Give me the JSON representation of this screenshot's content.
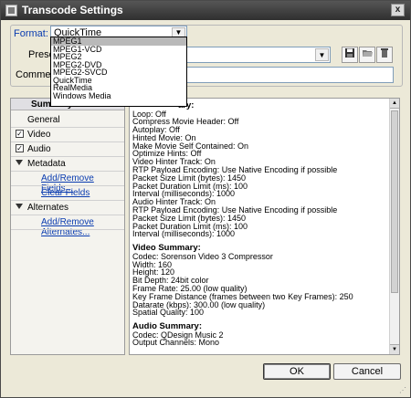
{
  "window": {
    "title": "Transcode Settings",
    "close_glyph": "x"
  },
  "format": {
    "label": "Format:",
    "value": "QuickTime"
  },
  "preset": {
    "label": "Preset",
    "value": ""
  },
  "comment": {
    "label": "Comment",
    "value": ""
  },
  "dropdown": {
    "options": [
      "MPEG1",
      "MPEG1-VCD",
      "MPEG2",
      "MPEG2-DVD",
      "MPEG2-SVCD",
      "QuickTime",
      "RealMedia",
      "Windows Media"
    ],
    "selected_index": 0
  },
  "toolbar": {
    "save_icon": "floppy-disk-icon",
    "open_icon": "folder-icon",
    "delete_icon": "trash-icon"
  },
  "tree": {
    "header": "Summary",
    "general": "General",
    "video": "Video",
    "audio": "Audio",
    "metadata": "Metadata",
    "add_remove_fields": "Add/Remove Fields...",
    "clear_fields": "Clear Fields",
    "alternates": "Alternates",
    "add_remove_alternates": "Add/Remove Alternates..."
  },
  "summary": {
    "partial_heading": "ary:",
    "general_lines": [
      "Loop: Off",
      "Compress Movie Header: Off",
      "Autoplay: Off",
      "Hinted Movie: On",
      "Make Movie Self Contained: On",
      "Optimize Hints: Off",
      "Video Hinter Track: On",
      "RTP Payload Encoding: Use Native Encoding if possible",
      "Packet Size Limit (bytes): 1450",
      "Packet Duration Limit (ms): 100",
      "Interval (milliseconds): 1000",
      "Audio Hinter Track: On",
      "RTP Payload Encoding: Use Native Encoding if possible",
      "Packet Size Limit (bytes): 1450",
      "Packet Duration Limit (ms): 100",
      "Interval (milliseconds): 1000"
    ],
    "video_heading": "Video Summary:",
    "video_lines": [
      "Codec: Sorenson Video 3 Compressor",
      "Width: 160",
      "Height: 120",
      "Bit Depth: 24bit color",
      "Frame Rate: 25.00 (low quality)",
      "Key Frame Distance (frames between two Key Frames): 250",
      "Datarate (kbps): 300.00 (low quality)",
      "Spatial Quality: 100"
    ],
    "audio_heading": "Audio Summary:",
    "audio_lines": [
      "Codec: QDesign Music 2",
      "Output Channels: Mono"
    ]
  },
  "buttons": {
    "ok": "OK",
    "cancel": "Cancel"
  },
  "colors": {
    "link": "#0a3cb0",
    "titlebar": "#3a3a3a",
    "selection": "#b9b9b9"
  }
}
